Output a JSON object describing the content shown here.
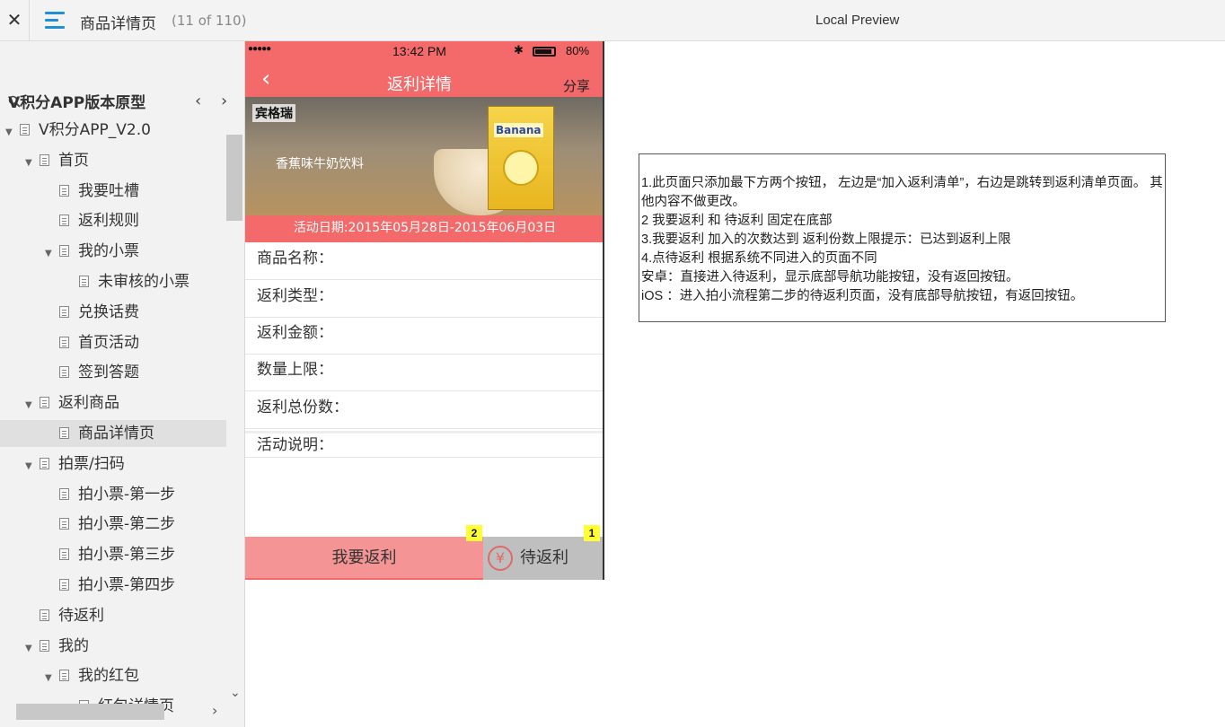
{
  "topbar": {
    "close_glyph": "✕",
    "page_title": "商品详情页",
    "page_count": "(11 of 110)",
    "preview_label": "Local Preview"
  },
  "sidebar": {
    "nav_prev": "‹",
    "nav_next": "›",
    "project_title": "V积分APP版本原型",
    "items": [
      {
        "label": "V积分APP_V2.0",
        "level": 0,
        "expanded": true
      },
      {
        "label": "首页",
        "level": 1,
        "expanded": true
      },
      {
        "label": "我要吐槽",
        "level": 2
      },
      {
        "label": "返利规则",
        "level": 2
      },
      {
        "label": "我的小票",
        "level": 2,
        "expanded": true
      },
      {
        "label": "未审核的小票",
        "level": 3
      },
      {
        "label": "兑换话费",
        "level": 2
      },
      {
        "label": "首页活动",
        "level": 2
      },
      {
        "label": "签到答题",
        "level": 2
      },
      {
        "label": "返利商品",
        "level": 1,
        "expanded": true
      },
      {
        "label": "商品详情页",
        "level": 2,
        "selected": true
      },
      {
        "label": "拍票/扫码",
        "level": 1,
        "expanded": true
      },
      {
        "label": "拍小票-第一步",
        "level": 2
      },
      {
        "label": "拍小票-第二步",
        "level": 2
      },
      {
        "label": "拍小票-第三步",
        "level": 2
      },
      {
        "label": "拍小票-第四步",
        "level": 2
      },
      {
        "label": "待返利",
        "level": 1
      },
      {
        "label": "我的",
        "level": 1,
        "expanded": true
      },
      {
        "label": "我的红包",
        "level": 2,
        "expanded": true
      },
      {
        "label": "红包详情页",
        "level": 3
      }
    ]
  },
  "phone": {
    "status": {
      "signal": "●●●●● ",
      "time": "13:42 PM",
      "bluetooth": "✱",
      "battery_pct": "80%"
    },
    "navbar": {
      "back_glyph": "‹",
      "title": "返利详情",
      "share": "分享"
    },
    "banner": {
      "brand": "宾格瑞",
      "product_text": "香蕉味牛奶饮料",
      "box_label": "Banana"
    },
    "date_strip": "活动日期:2015年05月28日-2015年06月03日",
    "fields": [
      {
        "label": "商品名称："
      },
      {
        "label": "返利类型："
      },
      {
        "label": "返利金额："
      },
      {
        "label": "数量上限："
      },
      {
        "label": "返利总份数："
      },
      {
        "label": "活动说明："
      }
    ],
    "bottom_bar": {
      "left_label": "我要返利",
      "right_label": "待返利",
      "yen_glyph": "¥",
      "left_badge": "2",
      "right_badge": "1"
    }
  },
  "note": {
    "lines": [
      "1.此页面只添加最下方两个按钮， 左边是“加入返利清单”，右边是跳转到返利清单页面。 其他内容不做更改。",
      "2 我要返利 和 待返利  固定在底部",
      "3.我要返利 加入的次数达到 返利份数上限提示：已达到返利上限",
      "4.点待返利 根据系统不同进入的页面不同",
      "安卓：直接进入待返利，显示底部导航功能按钮，没有返回按钮。",
      "iOS ：进入拍小流程第二步的待返利页面，没有底部导航按钮，有返回按钮。"
    ]
  },
  "colors": {
    "phone_red": "#f46a6a",
    "button_pink": "#f49494",
    "button_gray": "#bfbfbf",
    "accent_blue": "#1f8fd6",
    "badge_yellow": "#ffff33"
  }
}
